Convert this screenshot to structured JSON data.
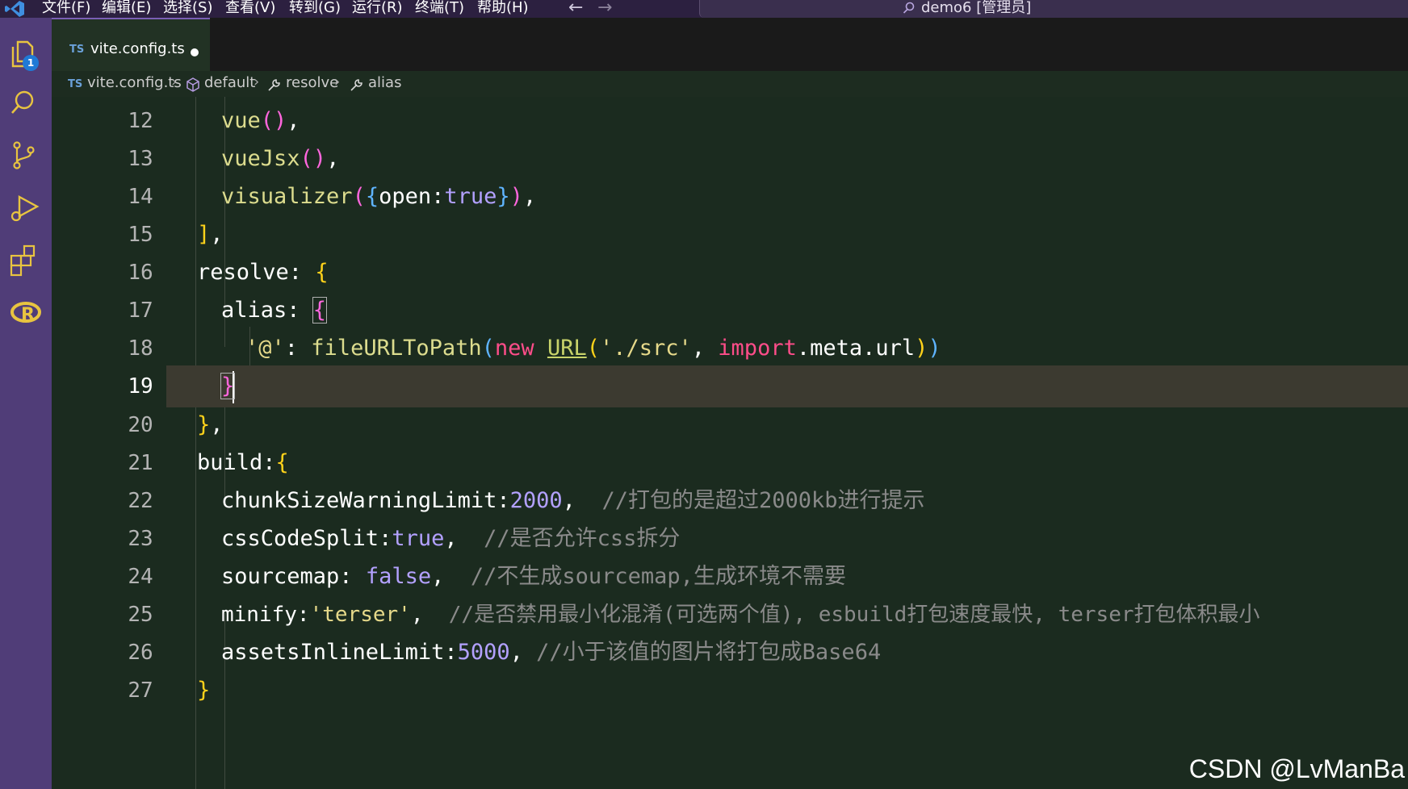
{
  "titlebar": {
    "menus": [
      "文件(F)",
      "编辑(E)",
      "选择(S)",
      "查看(V)",
      "转到(G)",
      "运行(R)",
      "终端(T)",
      "帮助(H)"
    ],
    "back": "←",
    "forward": "→",
    "search_text": "demo6 [管理员]"
  },
  "activity": {
    "explorer_badge": "1",
    "icons": [
      "files-icon",
      "search-icon",
      "source-control-icon",
      "run-debug-icon",
      "extensions-icon",
      "r-language-icon"
    ]
  },
  "tab": {
    "lang": "TS",
    "name": "vite.config.ts",
    "modified": true
  },
  "breadcrumb": {
    "items": [
      {
        "icon": "ts-file-icon",
        "label": "vite.config.ts"
      },
      {
        "icon": "module-icon",
        "label": "default"
      },
      {
        "icon": "wrench-icon",
        "label": "resolve"
      },
      {
        "icon": "wrench-icon",
        "label": "alias"
      }
    ]
  },
  "editor": {
    "current_line": 19,
    "lines": [
      {
        "num": "12",
        "text": "vue(),"
      },
      {
        "num": "13",
        "text": "vueJsx(),"
      },
      {
        "num": "14",
        "text": "visualizer({open:true}),"
      },
      {
        "num": "15",
        "text": "],"
      },
      {
        "num": "16",
        "text": "resolve: {"
      },
      {
        "num": "17",
        "text": "alias: {"
      },
      {
        "num": "18",
        "text": "'@': fileURLToPath(new URL('./src', import.meta.url))"
      },
      {
        "num": "19",
        "text": "}"
      },
      {
        "num": "20",
        "text": "},"
      },
      {
        "num": "21",
        "text": "build:{"
      },
      {
        "num": "22",
        "text": "chunkSizeWarningLimit:2000,  //打包的是超过2000kb进行提示"
      },
      {
        "num": "23",
        "text": "cssCodeSplit:true,  //是否允许css拆分"
      },
      {
        "num": "24",
        "text": "sourcemap: false,  //不生成sourcemap,生成环境不需要"
      },
      {
        "num": "25",
        "text": "minify:'terser',  //是否禁用最小化混淆(可选两个值), esbuild打包速度最快, terser打包体积最小"
      },
      {
        "num": "26",
        "text": "assetsInlineLimit:5000, //小于该值的图片将打包成Base64"
      },
      {
        "num": "27",
        "text": "}"
      }
    ]
  },
  "watermark": "CSDN @LvManBa",
  "colors": {
    "activity_bar": "#503d78",
    "editor_bg": "#1b2b1f",
    "current_line": "#3c3a30",
    "keyword": "#ff4d8a",
    "number": "#b3a1ff"
  }
}
